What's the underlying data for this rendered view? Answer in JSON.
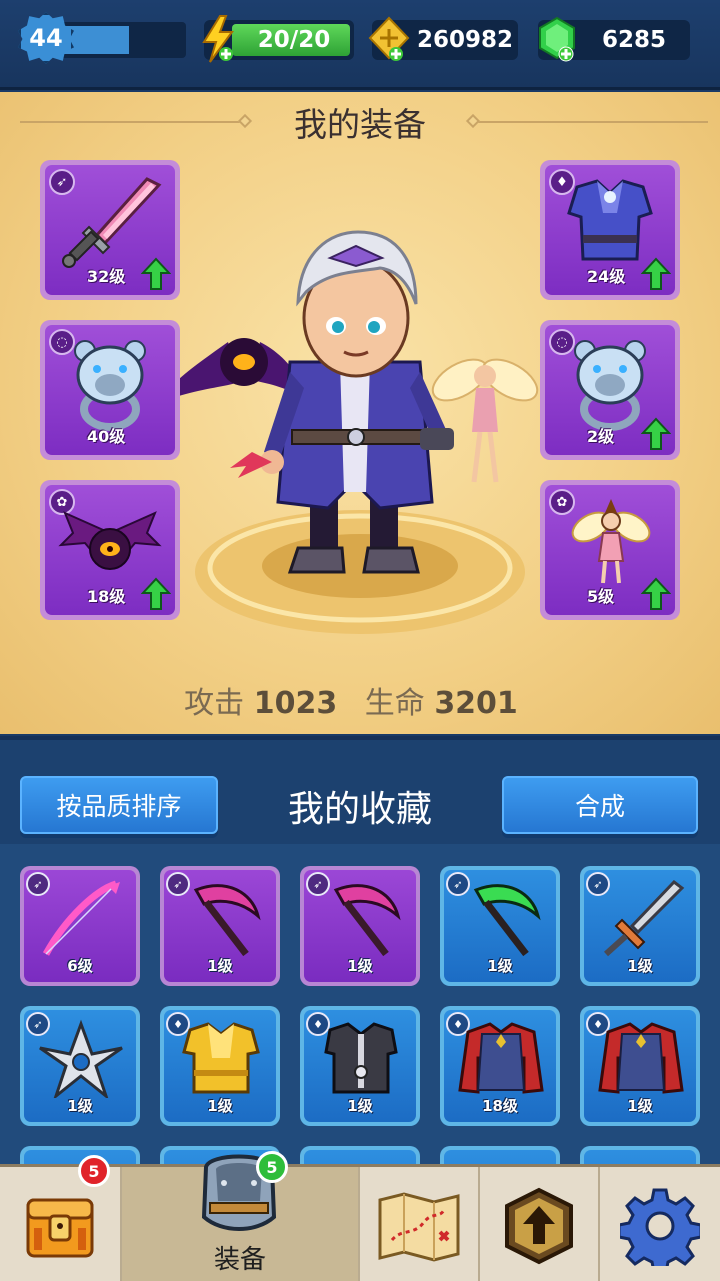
{
  "topbar": {
    "level": "44",
    "xp_fraction": 0.55,
    "energy": "20/20",
    "gold": "260982",
    "gems": "6285"
  },
  "equip": {
    "title": "我的装备",
    "slots": [
      {
        "type_icon": "bow-type-icon",
        "art": "pink-sword-icon",
        "level": "32级",
        "upgradable": true
      },
      {
        "type_icon": "ring-type-icon",
        "art": "bear-ring-icon",
        "level": "40级",
        "upgradable": false
      },
      {
        "type_icon": "pet-type-icon",
        "art": "bat-pet-icon",
        "level": "18级",
        "upgradable": true
      },
      {
        "type_icon": "armor-type-icon",
        "art": "purple-armor-icon",
        "level": "24级",
        "upgradable": true
      },
      {
        "type_icon": "ring-type-icon",
        "art": "bear-ring-icon",
        "level": "2级",
        "upgradable": true
      },
      {
        "type_icon": "pet-type-icon",
        "art": "fairy-pet-icon",
        "level": "5级",
        "upgradable": true
      }
    ],
    "stats": {
      "attack_label": "攻击",
      "attack_value": "1023",
      "hp_label": "生命",
      "hp_value": "3201"
    }
  },
  "collection": {
    "sort_button": "按品质排序",
    "title": "我的收藏",
    "merge_button": "合成",
    "items": [
      {
        "rarity": "purple",
        "art": "bow-icon",
        "level": "6级"
      },
      {
        "rarity": "purple",
        "art": "scythe-icon",
        "level": "1级"
      },
      {
        "rarity": "purple",
        "art": "scythe-icon",
        "level": "1级"
      },
      {
        "rarity": "blue",
        "art": "green-scythe-icon",
        "level": "1级"
      },
      {
        "rarity": "blue",
        "art": "sword-icon",
        "level": "1级"
      },
      {
        "rarity": "blue",
        "art": "shuriken-icon",
        "level": "1级"
      },
      {
        "rarity": "blue",
        "art": "gold-armor-icon",
        "level": "1级"
      },
      {
        "rarity": "blue",
        "art": "dark-vest-icon",
        "level": "1级"
      },
      {
        "rarity": "blue",
        "art": "red-robe-icon",
        "level": "18级"
      },
      {
        "rarity": "blue",
        "art": "red-robe-icon",
        "level": "1级"
      }
    ]
  },
  "nav": {
    "chest_badge": "5",
    "equip_badge": "5",
    "equip_label": "装备"
  },
  "colors": {
    "epic": "#8a35cc",
    "rare": "#2277d0",
    "upgrade_green": "#2ecc40"
  }
}
